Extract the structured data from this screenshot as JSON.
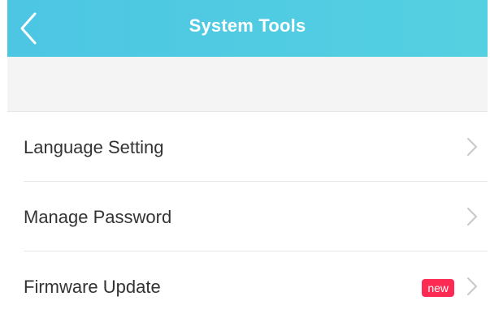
{
  "header": {
    "title": "System Tools",
    "back_icon": "chevron-left-icon",
    "background_colors": [
      "#4cc6e3",
      "#54d0e1"
    ]
  },
  "menu": {
    "items": [
      {
        "label": "Language Setting",
        "icon": "chevron-right-icon"
      },
      {
        "label": "Manage Password",
        "icon": "chevron-right-icon"
      },
      {
        "label": "Firmware Update",
        "badge": "new",
        "icon": "chevron-right-icon"
      }
    ]
  },
  "colors": {
    "badge": "#fd2a54",
    "text": "#333333",
    "chevron": "#c7c7cc",
    "divider": "#e6e6e6",
    "band": "#f4f4f4"
  }
}
